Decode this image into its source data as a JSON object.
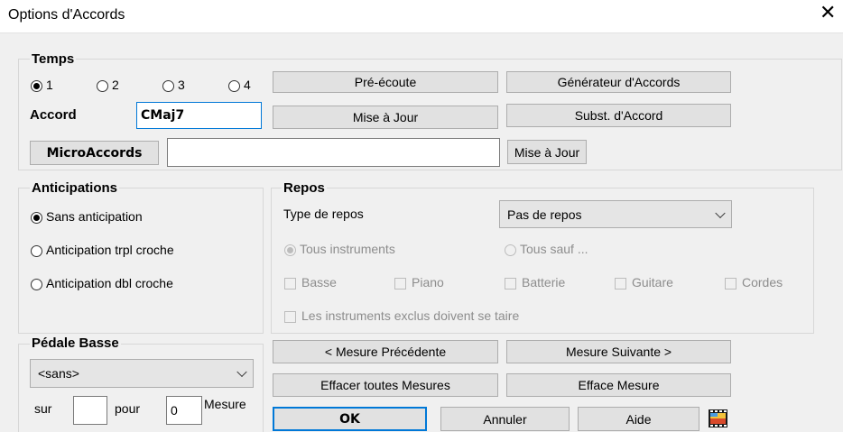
{
  "window": {
    "title": "Options d'Accords",
    "close_glyph": "✕"
  },
  "temps": {
    "title": "Temps",
    "radios": [
      {
        "label": "1",
        "checked": true
      },
      {
        "label": "2",
        "checked": false
      },
      {
        "label": "3",
        "checked": false
      },
      {
        "label": "4",
        "checked": false
      }
    ],
    "accord_label": "Accord",
    "accord_value": "CMaj7",
    "preecoute": "Pré-écoute",
    "generateur": "Générateur d'Accords",
    "mise_a_jour": "Mise à Jour",
    "subst": "Subst. d'Accord",
    "microaccords": "MicroAccords",
    "micro_value": "",
    "micro_update": "Mise à Jour"
  },
  "anticipations": {
    "title": "Anticipations",
    "options": [
      {
        "label": "Sans anticipation",
        "checked": true
      },
      {
        "label": "Anticipation trpl croche",
        "checked": false
      },
      {
        "label": "Anticipation dbl croche",
        "checked": false
      }
    ]
  },
  "repos": {
    "title": "Repos",
    "type_label": "Type de repos",
    "type_value": "Pas de repos",
    "tous_instruments": "Tous instruments",
    "tous_sauf": "Tous sauf ...",
    "instruments": [
      "Basse",
      "Piano",
      "Batterie",
      "Guitare",
      "Cordes"
    ],
    "exclus": "Les instruments exclus doivent se taire"
  },
  "pedale": {
    "title": "Pédale Basse",
    "select_value": "<sans>",
    "sur_label": "sur",
    "sur_value": "",
    "pour_label": "pour",
    "pour_value": "0",
    "mesure_label": "Mesure"
  },
  "nav": {
    "prev": "< Mesure Précédente",
    "next": "Mesure Suivante >",
    "clear_all": "Effacer toutes Mesures",
    "clear": "Efface Mesure"
  },
  "footer": {
    "ok": "OK",
    "cancel": "Annuler",
    "help": "Aide"
  },
  "colors": {
    "focus_border": "#0078d7",
    "dialog_bg": "#f0f0f0",
    "button_bg": "#e1e1e1"
  }
}
